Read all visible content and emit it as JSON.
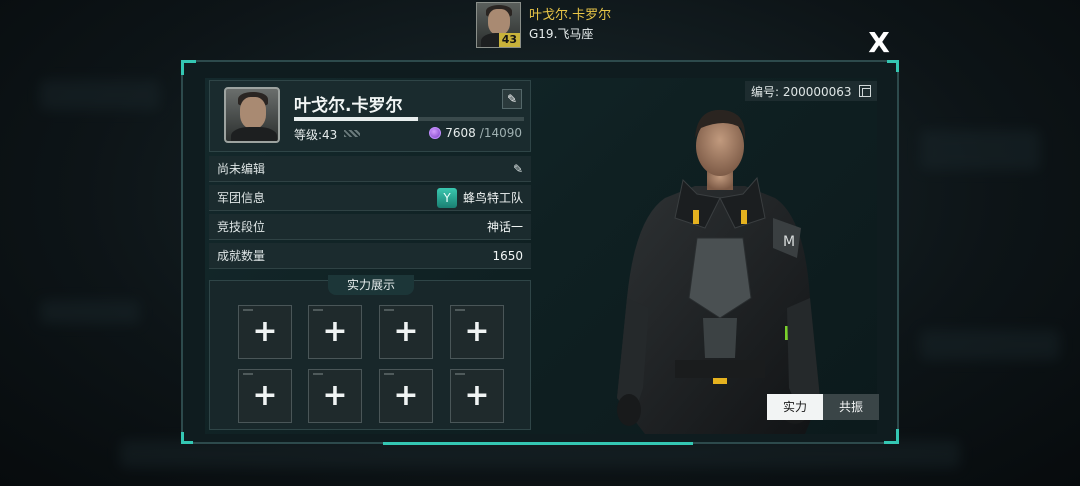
{
  "header": {
    "player_name": "叶戈尔.卡罗尔",
    "server": "G19.飞马座",
    "level_badge": "43"
  },
  "close_label": "X",
  "profile": {
    "name": "叶戈尔.卡罗尔",
    "edit_icon": "pencil-icon",
    "level_label": "等级:43",
    "exp_current": "7608",
    "exp_sep": "/14090",
    "exp_fraction": 0.54,
    "id_label": "编号: 200000063"
  },
  "info_rows": [
    {
      "label": "尚未编辑",
      "value": ""
    },
    {
      "label": "军团信息",
      "value": "蜂鸟特工队"
    },
    {
      "label": "竞技段位",
      "value": "神话一"
    },
    {
      "label": "成就数量",
      "value": "1650"
    }
  ],
  "showcase": {
    "title": "实力展示",
    "slot_symbol": "+"
  },
  "tabs": [
    {
      "label": "实力",
      "active": true
    },
    {
      "label": "共振",
      "active": false
    }
  ],
  "colors": {
    "accent": "#34c7b3",
    "name_gold": "#e8c547",
    "exp_gem": "#a05ae6"
  }
}
